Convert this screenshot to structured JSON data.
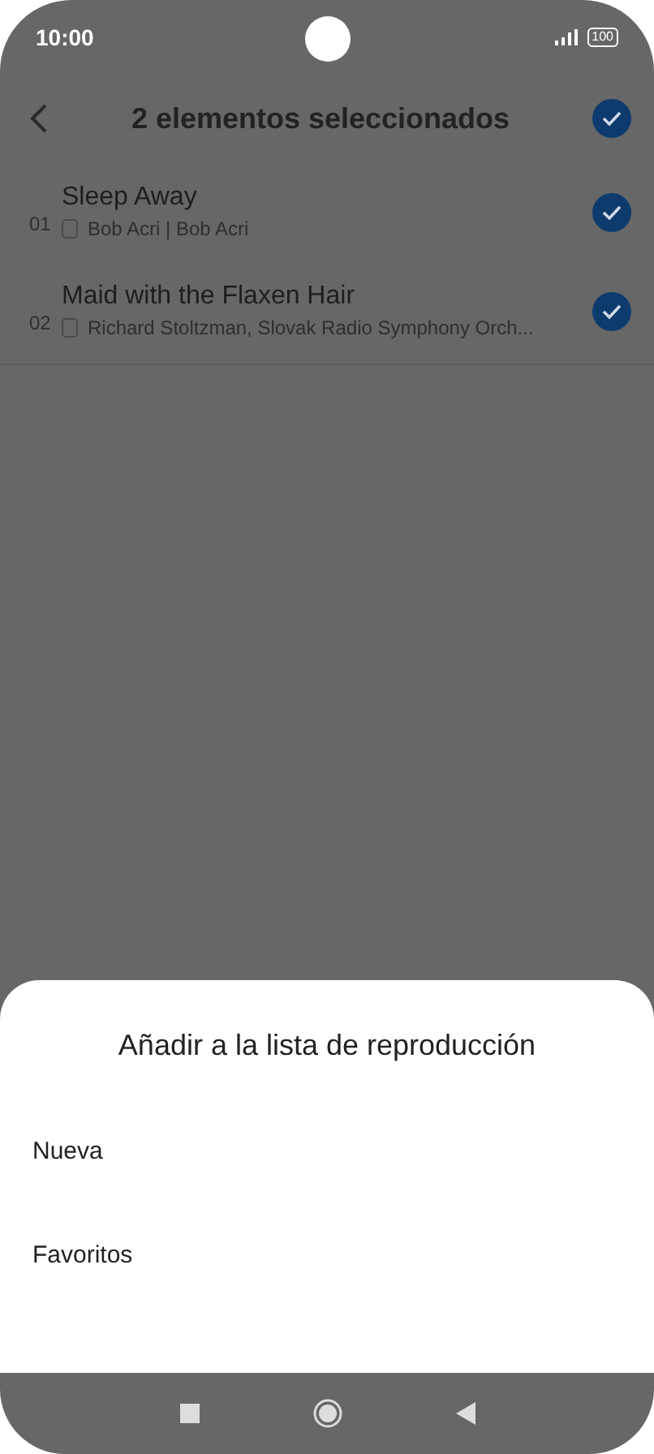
{
  "status_bar": {
    "time": "10:00",
    "battery": "100"
  },
  "header": {
    "title": "2 elementos seleccionados",
    "select_all_selected": true
  },
  "tracks": [
    {
      "number": "01",
      "title": "Sleep Away",
      "subtitle": "Bob Acri | Bob Acri",
      "selected": true
    },
    {
      "number": "02",
      "title": "Maid with the Flaxen Hair",
      "subtitle": "Richard Stoltzman, Slovak Radio Symphony Orch...",
      "selected": true
    }
  ],
  "sheet": {
    "title": "Añadir a la lista de reproducción",
    "options": [
      "Nueva",
      "Favoritos"
    ]
  }
}
